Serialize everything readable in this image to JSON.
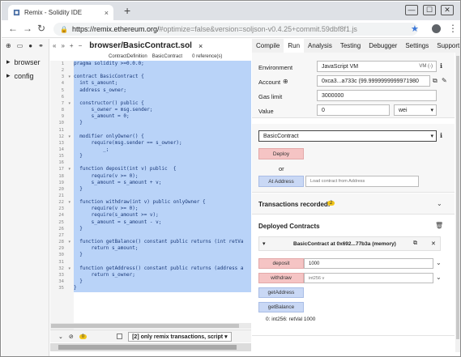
{
  "browser": {
    "tab_title": "Remix - Solidity IDE",
    "tab_close": "×",
    "new_tab": "+",
    "window_buttons": [
      "—",
      "☐",
      "✕"
    ],
    "nav": [
      "←",
      "→",
      "↻"
    ],
    "url_host": "https://remix.ethereum.org/",
    "url_rest": "#optimize=false&version=soljson-v0.4.25+commit.59dbf8f1.js"
  },
  "file_panel": {
    "items": [
      {
        "label": "browser",
        "arrow": "▸"
      },
      {
        "label": "config",
        "arrow": "▸"
      }
    ]
  },
  "editor": {
    "tab_label": "browser/BasicContract.sol",
    "tab_close": "×",
    "info_kind": "ContractDefinition",
    "info_name": "BasicContract",
    "info_refs": "0 reference(s)",
    "lines": [
      {
        "n": "1",
        "code": "pragma solidity >=0.0.0;"
      },
      {
        "n": "2",
        "code": ""
      },
      {
        "n": "3",
        "code": "contract BasicContract {"
      },
      {
        "n": "4",
        "code": "  int s_amount;"
      },
      {
        "n": "5",
        "code": "  address s_owner;"
      },
      {
        "n": "6",
        "code": ""
      },
      {
        "n": "7",
        "code": "  constructor() public {"
      },
      {
        "n": "8",
        "code": "      s_owner = msg.sender;"
      },
      {
        "n": "9",
        "code": "      s_amount = 0;"
      },
      {
        "n": "10",
        "code": "  }"
      },
      {
        "n": "11",
        "code": ""
      },
      {
        "n": "12",
        "code": "  modifier onlyOwner() {"
      },
      {
        "n": "13",
        "code": "      require(msg.sender == s_owner);"
      },
      {
        "n": "14",
        "code": "          _;"
      },
      {
        "n": "15",
        "code": "  }"
      },
      {
        "n": "16",
        "code": ""
      },
      {
        "n": "17",
        "code": "  function deposit(int v) public  {"
      },
      {
        "n": "18",
        "code": "      require(v >= 0);"
      },
      {
        "n": "19",
        "code": "      s_amount = s_amount + v;"
      },
      {
        "n": "20",
        "code": "  }"
      },
      {
        "n": "21",
        "code": ""
      },
      {
        "n": "22",
        "code": "  function withdraw(int v) public onlyOwner {"
      },
      {
        "n": "23",
        "code": "      require(v >= 0);"
      },
      {
        "n": "24",
        "code": "      require(s_amount >= v);"
      },
      {
        "n": "25",
        "code": "      s_amount = s_amount - v;"
      },
      {
        "n": "26",
        "code": "  }"
      },
      {
        "n": "27",
        "code": ""
      },
      {
        "n": "28",
        "code": "  function getBalance() constant public returns (int retVa"
      },
      {
        "n": "29",
        "code": "      return s_amount;"
      },
      {
        "n": "30",
        "code": "  }"
      },
      {
        "n": "31",
        "code": ""
      },
      {
        "n": "32",
        "code": "  function getAddress() constant public returns (address a"
      },
      {
        "n": "33",
        "code": "      return s_owner;"
      },
      {
        "n": "34",
        "code": "  }"
      },
      {
        "n": "35",
        "code": "}"
      }
    ]
  },
  "terminal": {
    "badge": "0",
    "filter": "[2] only remix transactions, script",
    "filter_arrow": "▾"
  },
  "right_tabs": [
    "Compile",
    "Run",
    "Analysis",
    "Testing",
    "Debugger",
    "Settings",
    "Support"
  ],
  "run": {
    "environment_label": "Environment",
    "environment_value": "JavaScript VM",
    "environment_extra": "VM (-)",
    "account_label": "Account",
    "account_value": "0xca3...a733c (99.9999999999971980",
    "gas_label": "Gas limit",
    "gas_value": "3000000",
    "value_label": "Value",
    "value_value": "0",
    "value_unit": "wei",
    "contract_select": "BasicContract",
    "deploy_label": "Deploy",
    "or_label": "or",
    "at_address_label": "At Address",
    "at_address_placeholder": "Load contract from Address",
    "tx_recorded_label": "Transactions recorded:",
    "tx_recorded_count": "2",
    "deployed_label": "Deployed Contracts",
    "instance_label": "BasicContract at 0x692...77b3a (memory)",
    "deposit_label": "deposit",
    "deposit_value": "1000",
    "withdraw_label": "withdraw",
    "withdraw_placeholder": "int256 v",
    "getaddress_label": "getAddress",
    "getbalance_label": "getBalance",
    "result": "0: int256: retVal 1000"
  }
}
